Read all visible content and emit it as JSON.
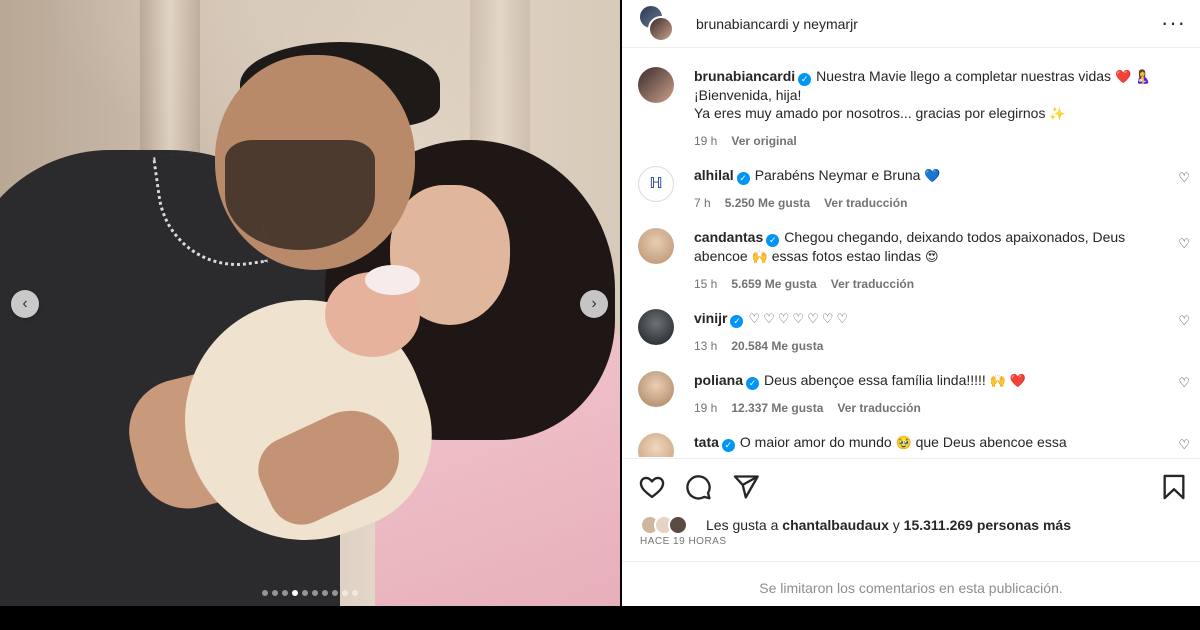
{
  "photo": {
    "prev_label": "‹",
    "next_label": "›",
    "dot_count": 10,
    "active_dot": 3
  },
  "header": {
    "title": "brunabiancardi y neymarjr",
    "more_label": "···"
  },
  "caption": {
    "username": "brunabiancardi",
    "line1": "Nuestra Mavie llego a completar nuestras vidas",
    "line1_emoji": "❤️ 🤱",
    "line2": "¡Bienvenida, hija!",
    "line3": "Ya eres muy amado por nosotros... gracias por elegirnos",
    "line3_emoji": "✨",
    "time": "19 h",
    "see_original": "Ver original"
  },
  "comments": [
    {
      "username": "alhilal",
      "text": "Parabéns Neymar e Bruna",
      "emoji": "💙",
      "time": "7 h",
      "likes": "5.250 Me gusta",
      "translate": "Ver traducción",
      "avatar_color": "#ffffff"
    },
    {
      "username": "candantas",
      "text": "Chegou chegando, deixando todos apaixonados, Deus abencoe",
      "emoji": "🙌",
      "text2": "essas fotos estao lindas",
      "emoji2": "😍",
      "time": "15 h",
      "likes": "5.659 Me gusta",
      "translate": "Ver traducción",
      "avatar_color": "#d8b99a"
    },
    {
      "username": "vinijr",
      "text": "",
      "emoji": "♡♡♡♡♡♡♡",
      "time": "13 h",
      "likes": "20.584 Me gusta",
      "translate": "",
      "avatar_color": "#2f3133"
    },
    {
      "username": "poliana",
      "text": "Deus abençoe essa família linda!!!!!",
      "emoji": "🙌 ❤️",
      "time": "19 h",
      "likes": "12.337 Me gusta",
      "translate": "Ver traducción",
      "avatar_color": "#c9a98a"
    },
    {
      "username": "tata",
      "text": "O maior amor do mundo",
      "emoji": "🥹",
      "text2": "que Deus abencoe essa",
      "time": "",
      "likes": "",
      "translate": "",
      "avatar_color": "#e0c4a8"
    }
  ],
  "likes_line": {
    "prefix": "Les gusta a",
    "user": "chantalbaudaux",
    "middle": "y",
    "count": "15.311.269 personas más"
  },
  "timestamp": "HACE 19 HORAS",
  "comments_limited": "Se limitaron los comentarios en esta publicación.",
  "icons": [
    "heart-icon",
    "comment-icon",
    "share-icon",
    "bookmark-icon"
  ]
}
